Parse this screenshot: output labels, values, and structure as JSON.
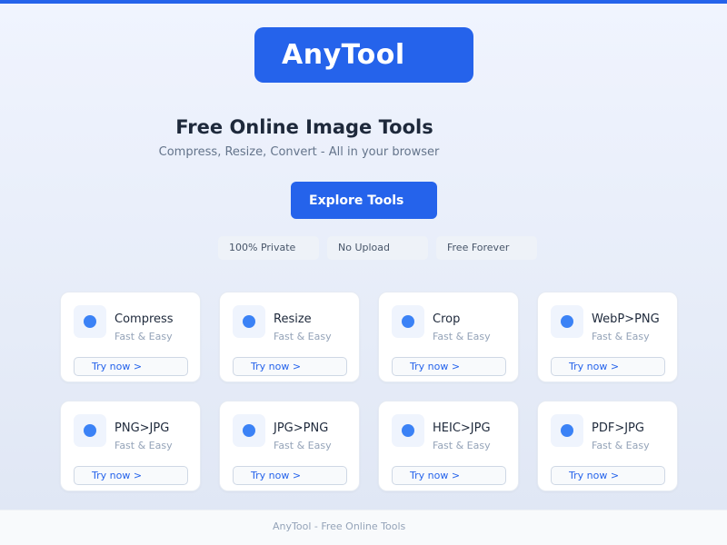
{
  "brand": {
    "logo_text": "AnyTool",
    "accent_color": "#2563eb"
  },
  "hero": {
    "title": "Free Online Image Tools",
    "subtitle": "Compress, Resize, Convert - All in your browser",
    "cta_label": "Explore Tools"
  },
  "badges": [
    "100% Private",
    "No Upload",
    "Free Forever"
  ],
  "tools": [
    {
      "name": "Compress",
      "subtitle": "Fast & Easy",
      "button_label": "Try now >"
    },
    {
      "name": "Resize",
      "subtitle": "Fast & Easy",
      "button_label": "Try now >"
    },
    {
      "name": "Crop",
      "subtitle": "Fast & Easy",
      "button_label": "Try now >"
    },
    {
      "name": "WebP>PNG",
      "subtitle": "Fast & Easy",
      "button_label": "Try now >"
    },
    {
      "name": "PNG>JPG",
      "subtitle": "Fast & Easy",
      "button_label": "Try now >"
    },
    {
      "name": "JPG>PNG",
      "subtitle": "Fast & Easy",
      "button_label": "Try now >"
    },
    {
      "name": "HEIC>JPG",
      "subtitle": "Fast & Easy",
      "button_label": "Try now >"
    },
    {
      "name": "PDF>JPG",
      "subtitle": "Fast & Easy",
      "button_label": "Try now >"
    }
  ],
  "tool_icon": "dot-icon",
  "footer": {
    "text": "AnyTool - Free Online Tools"
  }
}
